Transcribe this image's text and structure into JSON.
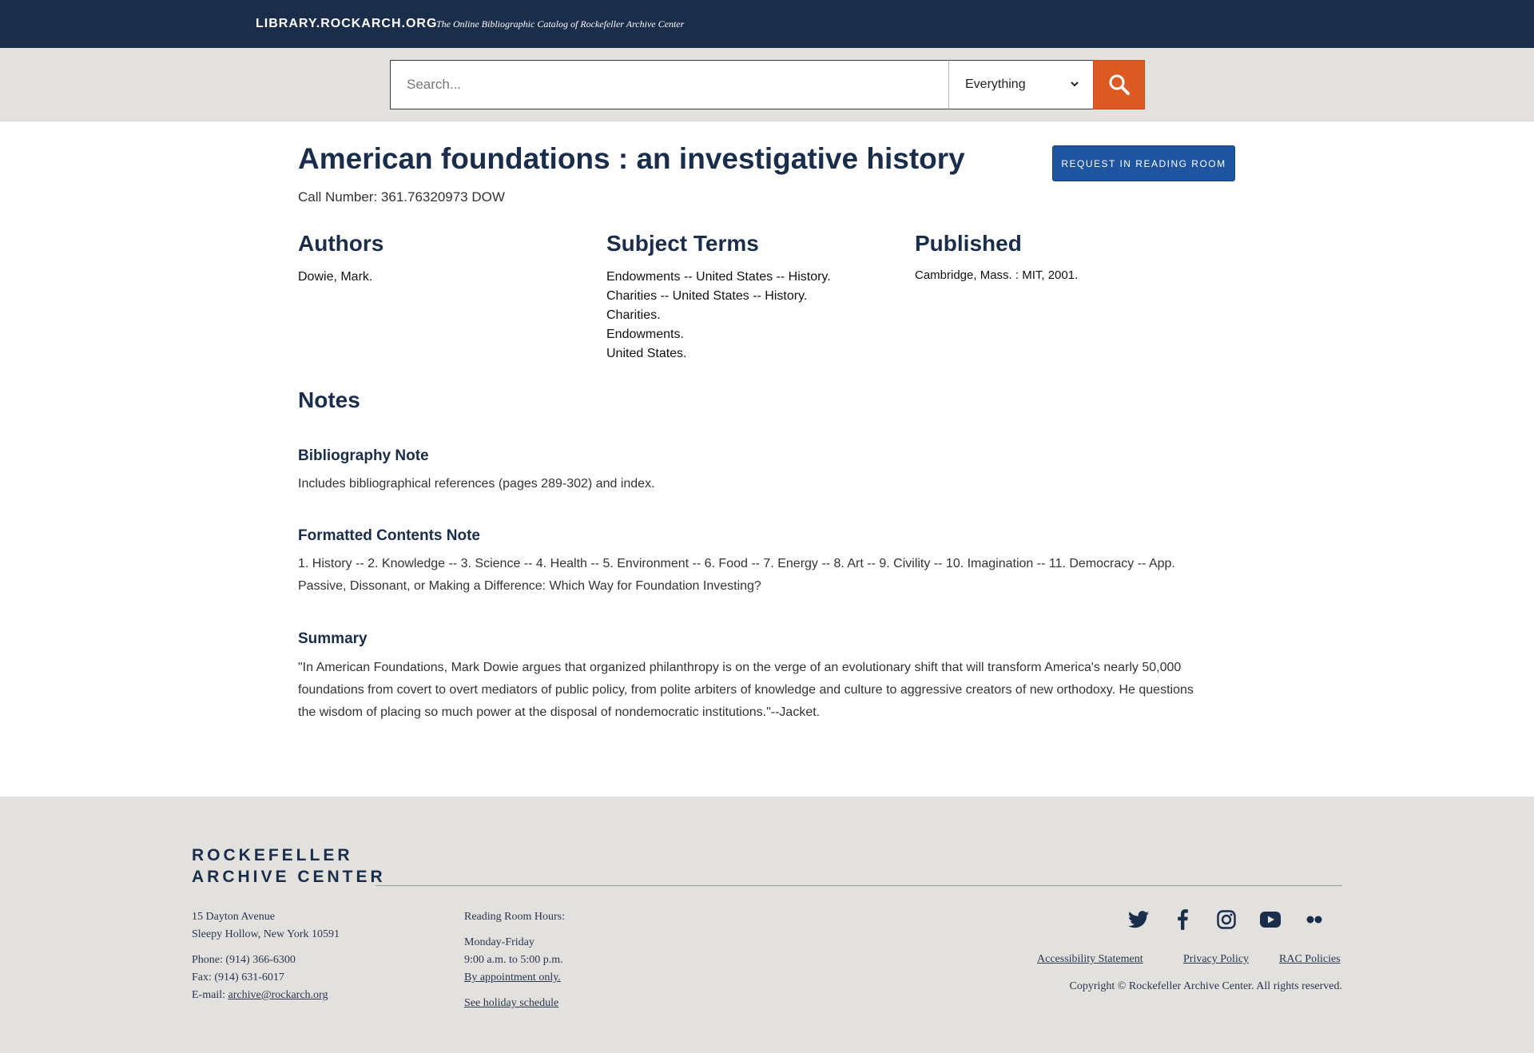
{
  "header": {
    "brand": "LIBRARY.ROCKARCH.ORG",
    "tagline": "The Online Bibliographic Catalog of Rockefeller Archive Center"
  },
  "search": {
    "placeholder": "Search...",
    "value": "",
    "scope": "Everything"
  },
  "record": {
    "title": "American foundations : an investigative history",
    "call_number": "Call Number: 361.76320973 DOW",
    "request_label": "REQUEST IN READING ROOM",
    "authors_heading": "Authors",
    "authors": [
      "Dowie, Mark."
    ],
    "subjects_heading": "Subject Terms",
    "subjects": [
      "Endowments -- United States -- History.",
      "Charities -- United States -- History.",
      "Charities.",
      "Endowments.",
      "United States."
    ],
    "published_heading": "Published",
    "published": "Cambridge, Mass. : MIT, 2001.",
    "notes_heading": "Notes",
    "notes": [
      {
        "title": "Bibliography Note",
        "text": "Includes bibliographical references (pages 289-302) and index."
      },
      {
        "title": "Formatted Contents Note",
        "text": "1. History -- 2. Knowledge -- 3. Science -- 4. Health -- 5. Environment -- 6. Food -- 7. Energy -- 8. Art -- 9. Civility -- 10. Imagination -- 11. Democracy -- App. Passive, Dissonant, or Making a Difference: Which Way for Foundation Investing?"
      },
      {
        "title": "Summary",
        "text": "\"In American Foundations, Mark Dowie argues that organized philanthropy is on the verge of an evolutionary shift that will transform America's nearly 50,000 foundations from covert to overt mediators of public policy, from polite arbiters of knowledge and culture to aggressive creators of new orthodoxy. He questions the wisdom of placing so much power at the disposal of nondemocratic institutions.\"--Jacket."
      }
    ]
  },
  "footer": {
    "logo_line1": "ROCKEFELLER",
    "logo_line2": "ARCHIVE CENTER",
    "address1": "15 Dayton Avenue",
    "address2": "Sleepy Hollow, New York 10591",
    "phone": "Phone: (914) 366-6300",
    "fax": "Fax: (914) 631-6017",
    "email_label": "E-mail: ",
    "email": "archive@rockarch.org",
    "hours_heading": "Reading Room Hours:",
    "hours_days": "Monday-Friday",
    "hours_time": "9:00 a.m. to 5:00 p.m.",
    "hours_appointment": "By appointment only.",
    "holiday_link": "See holiday schedule",
    "social_icons": [
      "twitter-icon",
      "facebook-icon",
      "instagram-icon",
      "youtube-icon",
      "flickr-icon"
    ],
    "links": [
      "Accessibility Statement",
      "Privacy Policy",
      "RAC Policies"
    ],
    "copyright": "Copyright © Rockefeller Archive Center. All rights reserved."
  },
  "colors": {
    "navy": "#1a2d4b",
    "search_orange": "#dd5a24",
    "request_blue": "#1f55a0",
    "footer_gray": "#e2e1dd"
  }
}
